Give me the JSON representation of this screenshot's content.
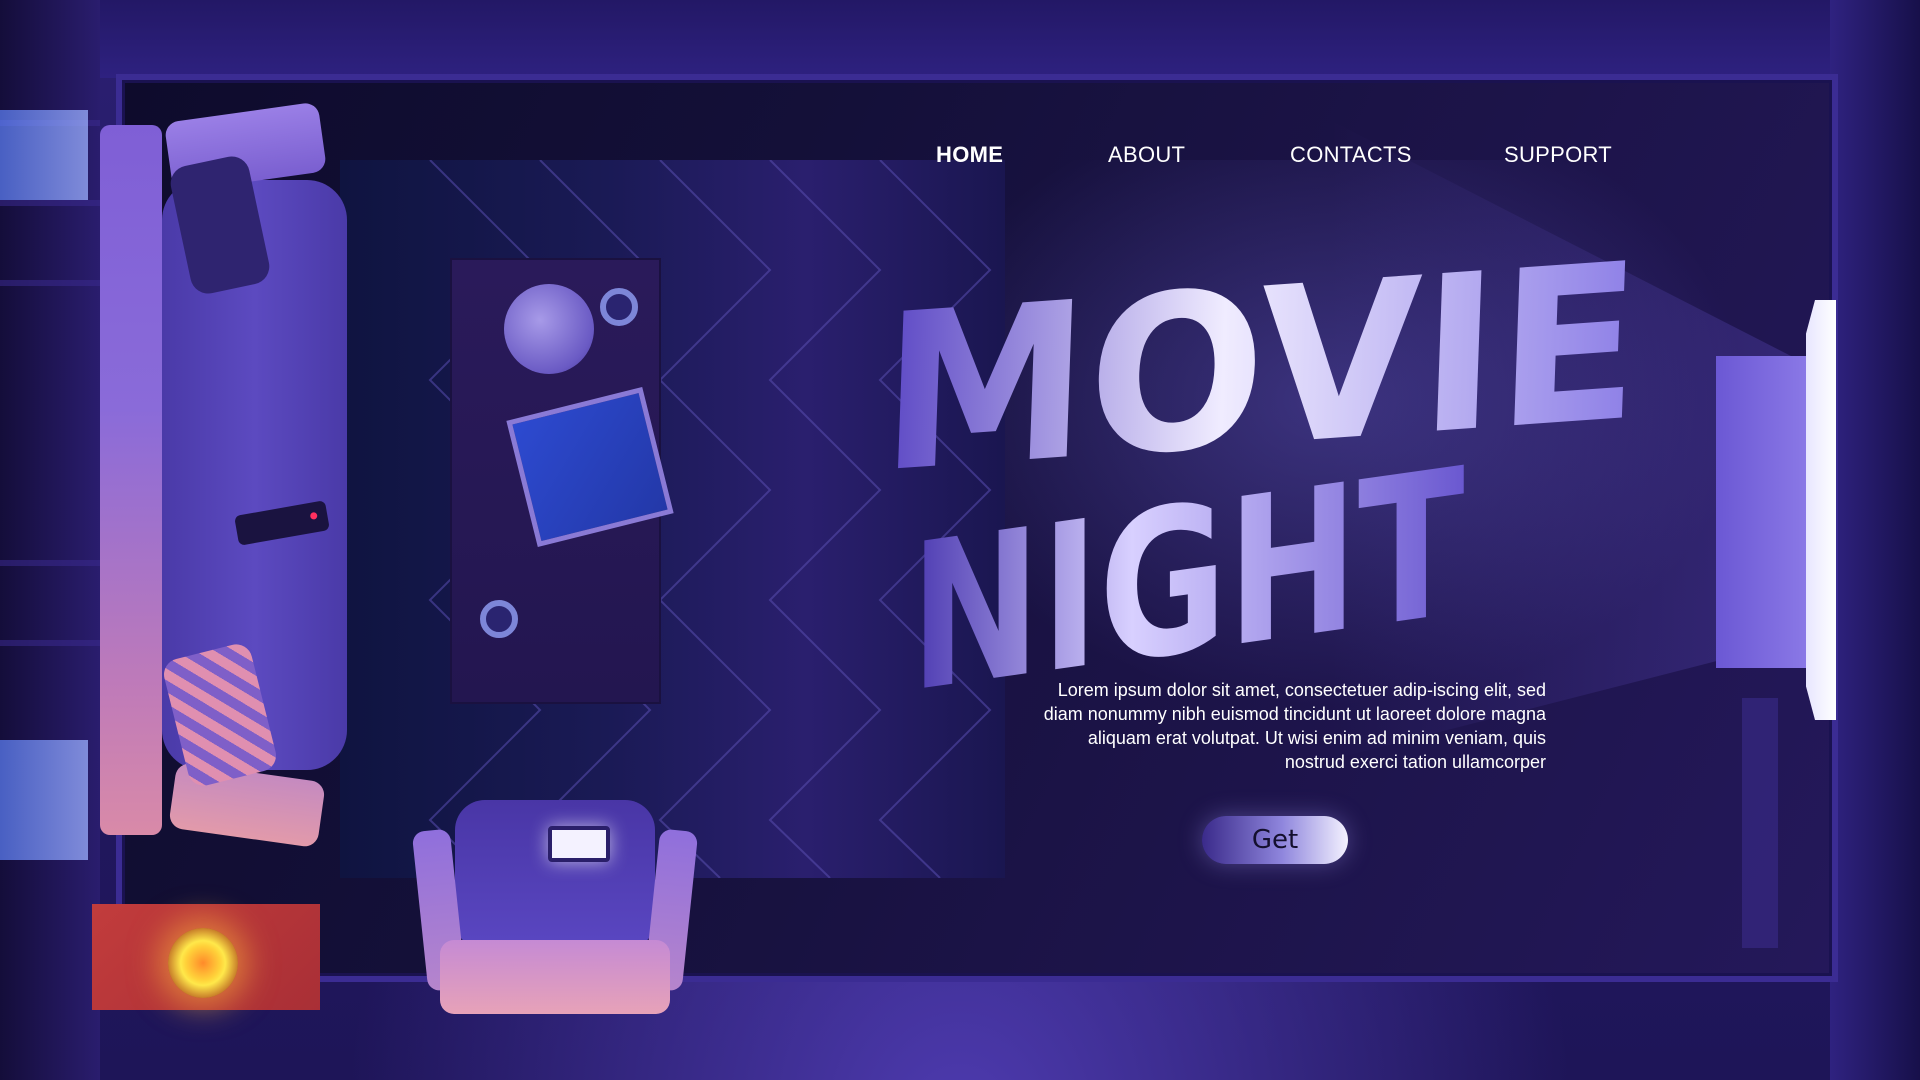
{
  "nav": {
    "items": [
      {
        "label": "HOME",
        "active": true
      },
      {
        "label": "ABOUT",
        "active": false
      },
      {
        "label": "CONTACTS",
        "active": false
      },
      {
        "label": "SUPPORT",
        "active": false
      }
    ]
  },
  "hero": {
    "title_line1": "MOVIE",
    "title_line2": "NIGHT",
    "body": "Lorem ipsum dolor sit amet, consectetuer adip-iscing elit, sed diam nonummy nibh euismod tincidunt ut laoreet dolore magna aliquam erat volutpat. Ut wisi enim ad minim veniam, quis nostrud exerci tation ullamcorper",
    "cta_label": "Get"
  },
  "colors": {
    "background": "#1c1350",
    "panel": "#141039",
    "accent": "#8f86dd",
    "title_light": "#eeeaff",
    "title_dark": "#5a46c4",
    "text": "#ffffff"
  },
  "icons": {
    "lamp": "lamp-icon",
    "mug": "mug-icon",
    "magazine": "magazine-icon",
    "remote": "remote-icon",
    "phone": "phone-icon",
    "tv": "tv-icon"
  }
}
